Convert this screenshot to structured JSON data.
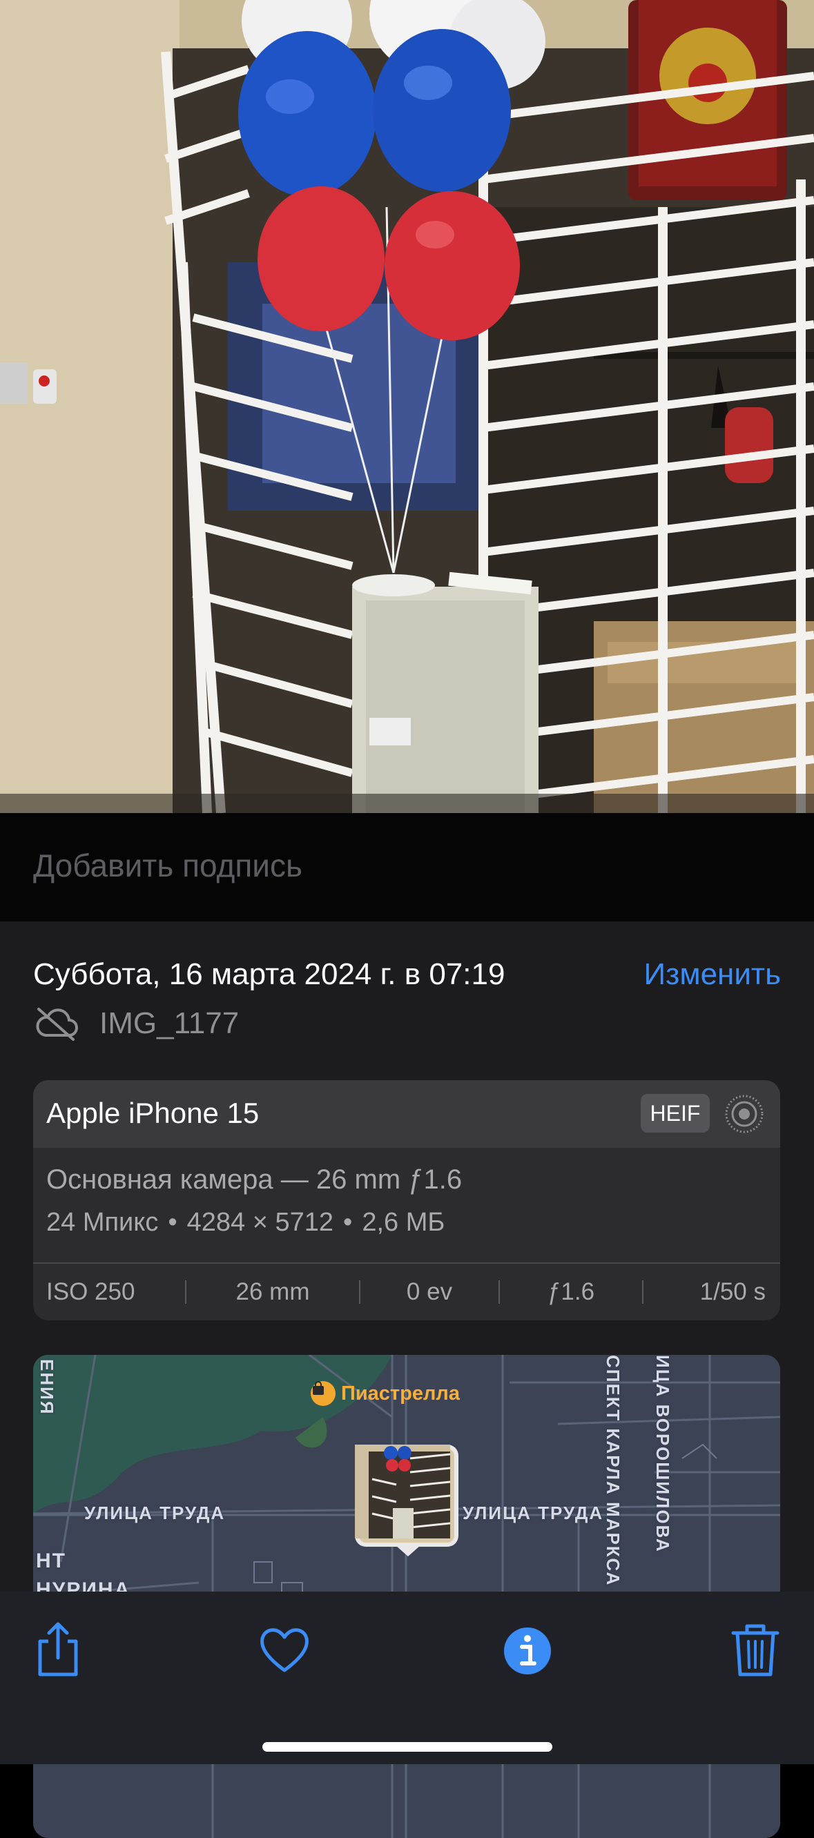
{
  "caption": {
    "placeholder": "Добавить подпись"
  },
  "info": {
    "date": "Суббота, 16 марта 2024 г. в 07:19",
    "edit_label": "Изменить",
    "file_name": "IMG_1177"
  },
  "camera": {
    "device": "Apple iPhone 15",
    "format": "HEIF",
    "lens": "Основная камера — 26 mm ƒ1.6",
    "megapixels": "24 Мпикс",
    "resolution": "4284 × 5712",
    "size": "2,6 МБ",
    "exif": [
      "ISO 250",
      "26 mm",
      "0 ev",
      "ƒ1.6",
      "1/50 s"
    ]
  },
  "map": {
    "poi": "Пиастрелла",
    "streets": {
      "trudа_left": "УЛИЦА ТРУДА",
      "truda_right": "УЛИЦА ТРУДА",
      "marksa": "СПЕКТ КАРЛА МАРКСА",
      "voroshilova": "ИЦА ВОРОШИЛОВА",
      "left_edge": "ЕНИЯ",
      "bottom_left_1": "НТ",
      "bottom_left_2": "НУРИНА"
    }
  },
  "toolbar": {
    "icons": [
      "share-icon",
      "heart-icon",
      "info-icon",
      "trash-icon"
    ],
    "accent": "#3b8cf5"
  },
  "colors": {
    "accent": "#3b8cf5",
    "panel": "#1c1c1e",
    "card": "#2c2c2e"
  }
}
